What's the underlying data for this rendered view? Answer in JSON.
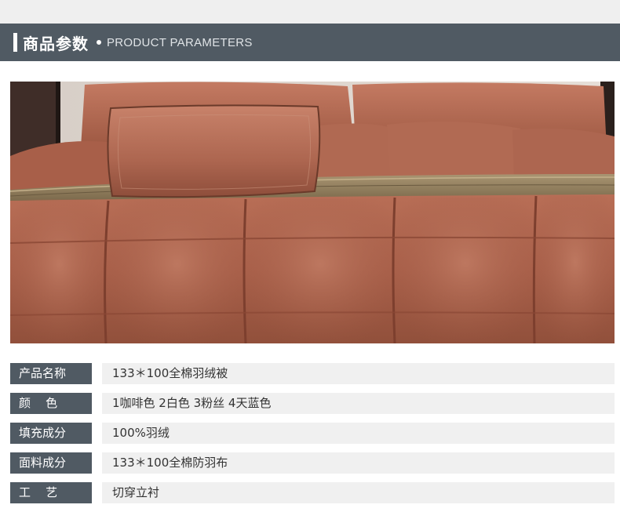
{
  "header": {
    "title": "商品参数",
    "subtitle": "PRODUCT PARAMETERS"
  },
  "photo": {
    "subject": "brown-down-comforter-bed-icon"
  },
  "colors": {
    "header_bg": "#505a63",
    "value_bg": "#f0f0f0",
    "comforter": "#a9604a"
  },
  "params": [
    {
      "label": "产品名称",
      "value": "133＊100全棉羽绒被"
    },
    {
      "label": "颜    色",
      "value": "1咖啡色 2白色 3粉丝 4天蓝色"
    },
    {
      "label": "填充成分",
      "value": "100%羽绒"
    },
    {
      "label": "面料成分",
      "value": "133＊100全棉防羽布"
    },
    {
      "label": "工    艺",
      "value": "切穿立衬"
    }
  ]
}
